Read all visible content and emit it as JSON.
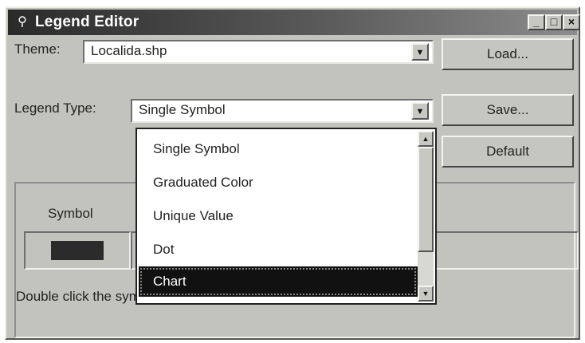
{
  "window": {
    "title": "Legend Editor",
    "app_icon": "magnifier-icon"
  },
  "titlebar_buttons": {
    "minimize": "_",
    "maximize": "□",
    "close": "×"
  },
  "theme": {
    "label": "Theme:",
    "value": "Localida.shp"
  },
  "legend_type": {
    "label": "Legend Type:",
    "value": "Single Symbol"
  },
  "buttons": {
    "load": "Load...",
    "save": "Save...",
    "default": "Default"
  },
  "table": {
    "symbol_header": "Symbol",
    "swatch_color": "#2b2b2b"
  },
  "hint": "Double click the symbol to edit.",
  "dropdown": {
    "items": [
      {
        "label": "Single Symbol",
        "selected": false
      },
      {
        "label": "Graduated Color",
        "selected": false
      },
      {
        "label": "Unique Value",
        "selected": false
      },
      {
        "label": "Dot",
        "selected": false
      },
      {
        "label": "Chart",
        "selected": true
      }
    ],
    "scroll_up": "▲",
    "scroll_down": "▼"
  },
  "dropdown_arrow": "▼"
}
